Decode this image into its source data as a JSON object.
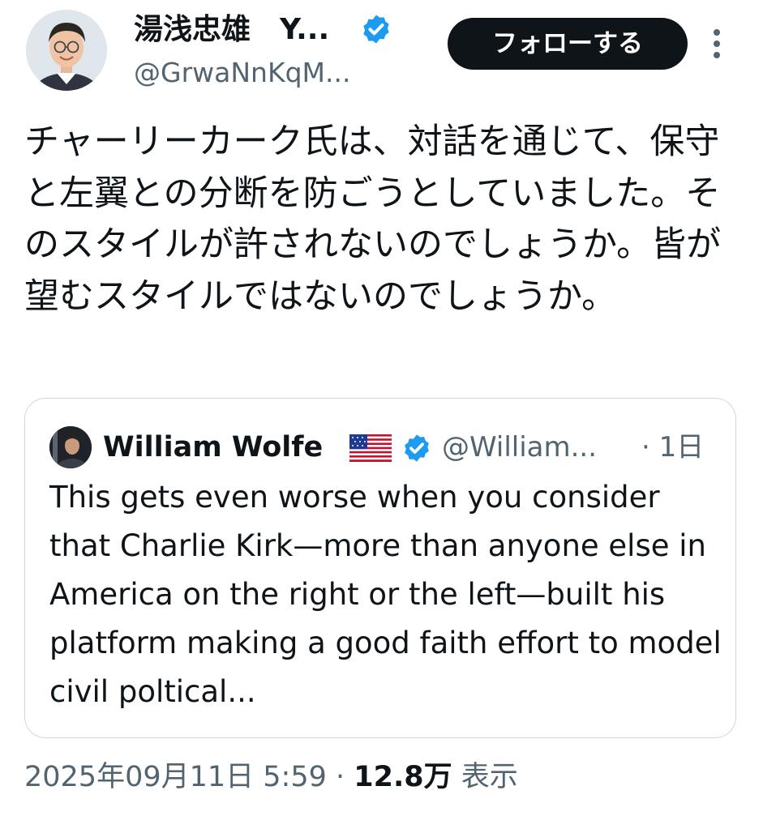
{
  "author": {
    "display_name": "湯浅忠雄　Y...",
    "handle": "@GrwaNnKqM...",
    "avatar_icon": "avatar-icon",
    "verified": true
  },
  "actions": {
    "follow_label": "フォローする",
    "more_icon": "more-icon"
  },
  "tweet": {
    "text": "チャーリーカーク氏は、対話を通じて、保守と左翼との分断を防ごうとしていました。そのスタイルが許されないのでしょうか。皆が望むスタイルではないのでしょうか。"
  },
  "quote": {
    "name": "William Wolfe",
    "flag_icon": "us-flag-icon",
    "verified": true,
    "handle": "@William...",
    "time": "· 1日",
    "text": "This gets even worse when you consider that Charlie Kirk—more than anyone else in America on the right or the left—built his platform making a good faith effort to model civil poltical..."
  },
  "meta": {
    "timestamp": "2025年09月11日 5:59",
    "separator": " · ",
    "views_count": "12.8万",
    "views_label": " 表示"
  },
  "colors": {
    "text": "#0f1419",
    "secondary": "#536471",
    "verified": "#1d9bf0",
    "border": "#cfd9de",
    "button_bg": "#0f1419"
  }
}
